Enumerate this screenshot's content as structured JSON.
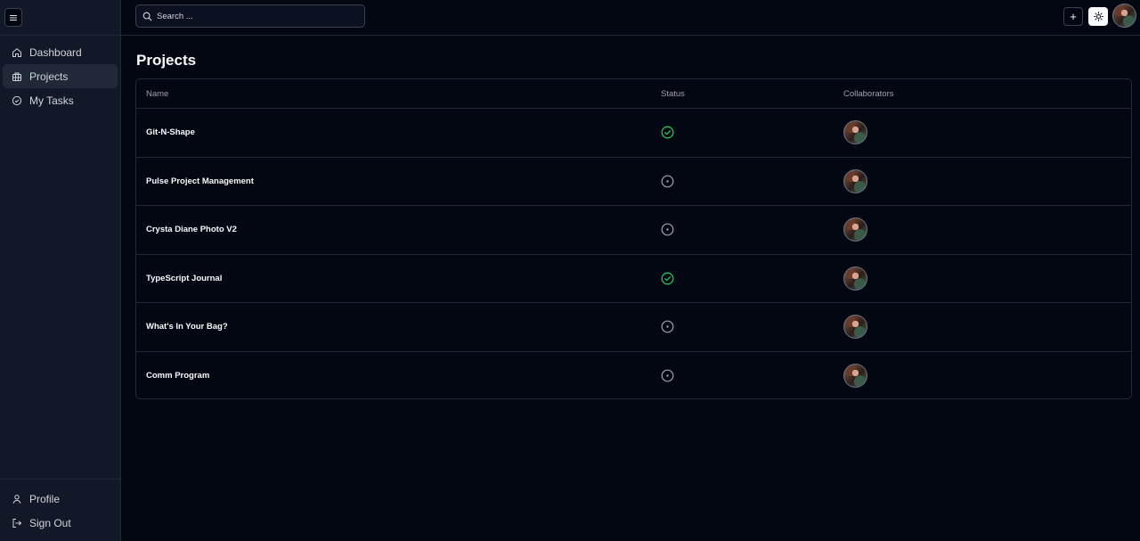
{
  "sidebar": {
    "menu_icon": "hamburger-icon",
    "items": [
      {
        "label": "Dashboard",
        "icon": "home-icon",
        "active": false
      },
      {
        "label": "Projects",
        "icon": "briefcase-icon",
        "active": true
      },
      {
        "label": "My Tasks",
        "icon": "check-circle-icon",
        "active": false
      }
    ],
    "bottom_items": [
      {
        "label": "Profile",
        "icon": "user-icon"
      },
      {
        "label": "Sign Out",
        "icon": "sign-out-icon"
      }
    ]
  },
  "header": {
    "search_placeholder": "Search ...",
    "add_label": "+",
    "theme_icon": "sun-icon",
    "avatar_icon": "user-avatar"
  },
  "main": {
    "title": "Projects",
    "table": {
      "columns": [
        "Name",
        "Status",
        "Collaborators"
      ],
      "rows": [
        {
          "name": "Git-N-Shape",
          "status": "completed"
        },
        {
          "name": "Pulse Project Management",
          "status": "in-progress"
        },
        {
          "name": "Crysta Diane Photo V2",
          "status": "in-progress"
        },
        {
          "name": "TypeScript Journal",
          "status": "completed"
        },
        {
          "name": "What's In Your Bag?",
          "status": "in-progress"
        },
        {
          "name": "Comm Program",
          "status": "in-progress"
        }
      ]
    }
  },
  "colors": {
    "background": "#030712",
    "sidebar": "#111827",
    "completed": "#22c55e",
    "in_progress": "#9ca3af",
    "border": "#1f2937"
  }
}
